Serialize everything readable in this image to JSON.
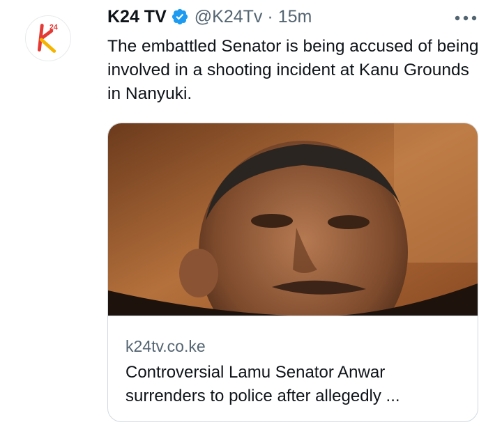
{
  "tweet": {
    "display_name": "K24 TV",
    "handle": "@K24Tv",
    "separator": "·",
    "time": "15m",
    "text": "The embattled Senator is being accused of being involved in a shooting incident at Kanu Grounds in Nanyuki.",
    "verified": true
  },
  "avatar": {
    "logo_letter": "k",
    "logo_superscript": "24",
    "colors": {
      "primary": "#e53935",
      "secondary": "#f5b400"
    }
  },
  "card": {
    "domain": "k24tv.co.ke",
    "title": "Controversial Lamu Senator Anwar surrenders to police after allegedly ..."
  },
  "icons": {
    "verified": "verified-badge-icon",
    "more": "more-horizontal-icon"
  },
  "colors": {
    "verified_blue": "#1d9bf0",
    "muted": "#536471",
    "text": "#0f1419",
    "border": "#cfd9de"
  }
}
